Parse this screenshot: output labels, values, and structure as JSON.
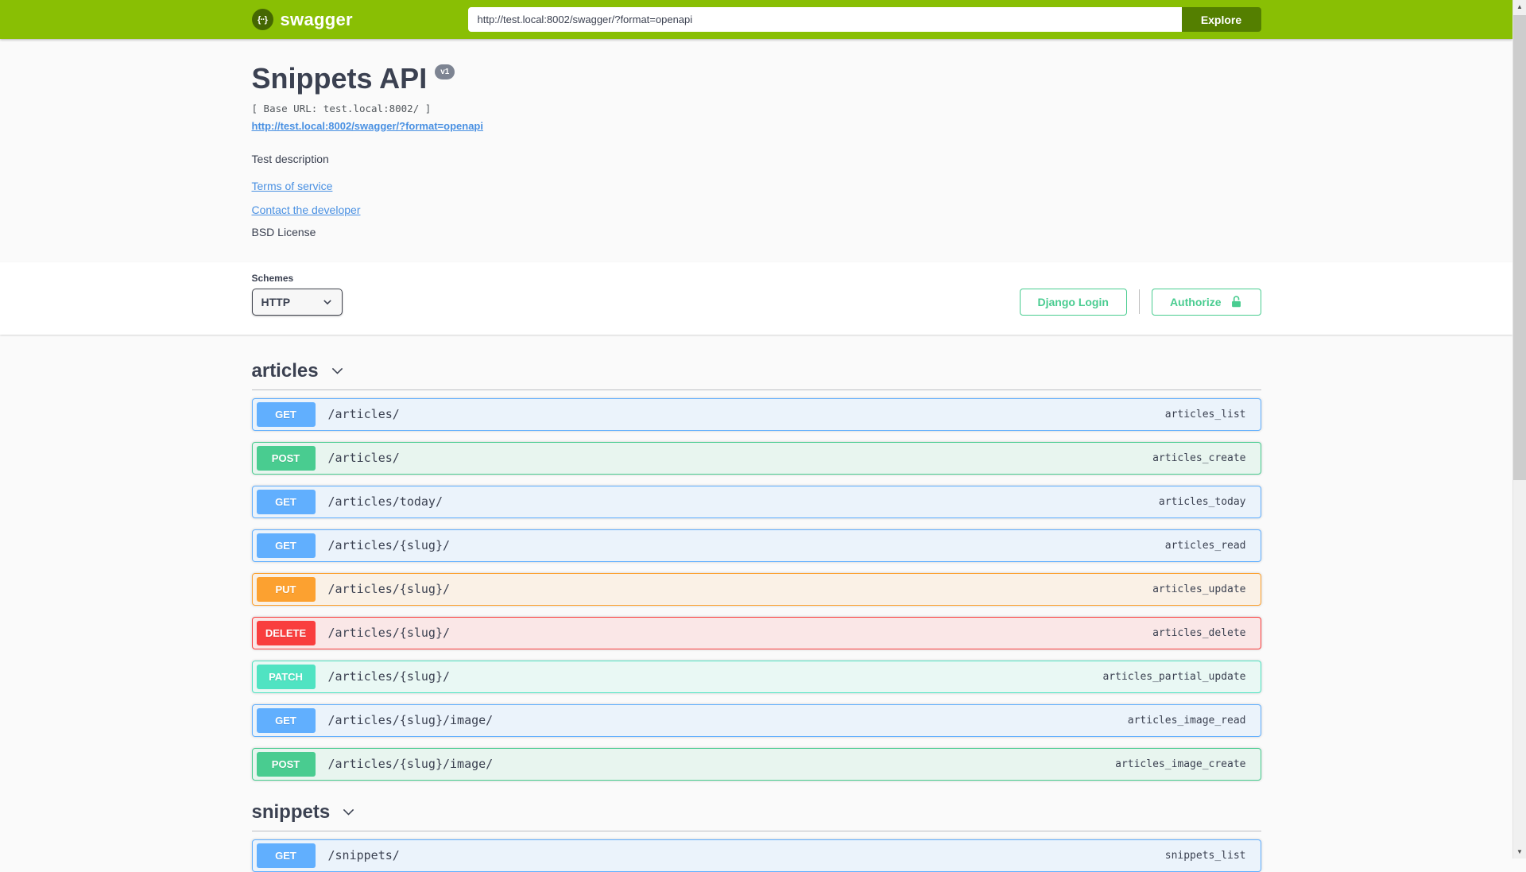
{
  "topbar": {
    "brand": "swagger",
    "logo_icon": "curly-braces",
    "url_value": "http://test.local:8002/swagger/?format=openapi",
    "explore_label": "Explore"
  },
  "colors": {
    "topbar_bg": "#89bf04",
    "explore_bg": "#547f00",
    "text_dark": "#3b4151",
    "link_blue": "#4990e2",
    "auth_green": "#49cc90",
    "page_bg": "#fafafa"
  },
  "info": {
    "title": "Snippets API",
    "version_badge": "v1",
    "base_url_line": "[ Base URL: test.local:8002/ ]",
    "spec_link": "http://test.local:8002/swagger/?format=openapi",
    "description": "Test description",
    "terms_link": "Terms of service",
    "contact_link": "Contact the developer",
    "license": "BSD License"
  },
  "schemes": {
    "label": "Schemes",
    "selected": "HTTP"
  },
  "auth": {
    "django_login_label": "Django Login",
    "authorize_label": "Authorize",
    "lock_icon": "unlocked-padlock"
  },
  "method_styles": {
    "GET": {
      "badge": "#61affe",
      "border": "#61affe",
      "bg": "#ebf3fb"
    },
    "POST": {
      "badge": "#49cc90",
      "border": "#49cc90",
      "bg": "#e8f5ef"
    },
    "PUT": {
      "badge": "#fca130",
      "border": "#fca130",
      "bg": "#faf1e6"
    },
    "DELETE": {
      "badge": "#f93e3e",
      "border": "#f93e3e",
      "bg": "#fae7e7"
    },
    "PATCH": {
      "badge": "#50e3c2",
      "border": "#50e3c2",
      "bg": "#e9f8f4"
    }
  },
  "sections": [
    {
      "name": "articles",
      "operations": [
        {
          "method": "GET",
          "path": "/articles/",
          "operation_id": "articles_list"
        },
        {
          "method": "POST",
          "path": "/articles/",
          "operation_id": "articles_create"
        },
        {
          "method": "GET",
          "path": "/articles/today/",
          "operation_id": "articles_today"
        },
        {
          "method": "GET",
          "path": "/articles/{slug}/",
          "operation_id": "articles_read"
        },
        {
          "method": "PUT",
          "path": "/articles/{slug}/",
          "operation_id": "articles_update"
        },
        {
          "method": "DELETE",
          "path": "/articles/{slug}/",
          "operation_id": "articles_delete"
        },
        {
          "method": "PATCH",
          "path": "/articles/{slug}/",
          "operation_id": "articles_partial_update"
        },
        {
          "method": "GET",
          "path": "/articles/{slug}/image/",
          "operation_id": "articles_image_read"
        },
        {
          "method": "POST",
          "path": "/articles/{slug}/image/",
          "operation_id": "articles_image_create"
        }
      ]
    },
    {
      "name": "snippets",
      "operations": [
        {
          "method": "GET",
          "path": "/snippets/",
          "operation_id": "snippets_list"
        }
      ]
    }
  ],
  "scrollbar": {
    "up_icon": "▲",
    "down_icon": "▼"
  }
}
